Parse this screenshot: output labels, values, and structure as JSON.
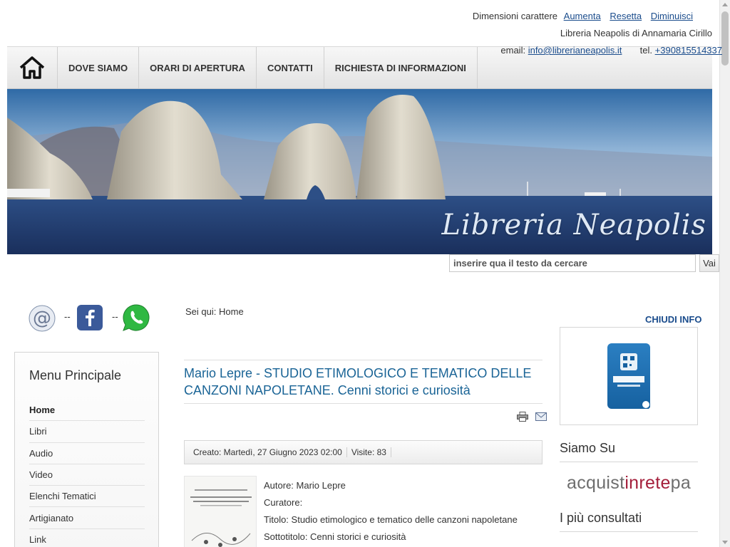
{
  "topbar": {
    "font_size_label": "Dimensioni carattere",
    "increase": "Aumenta",
    "reset": "Resetta",
    "decrease": "Diminuisci",
    "owner": "Libreria Neapolis di Annamaria Cirillo",
    "email_label": "email:",
    "email": "info@librerianeapolis.it",
    "phone_label": "tel.",
    "phone": "+390815514337"
  },
  "nav": {
    "home_icon": "home-icon",
    "items": [
      {
        "label": "DOVE SIAMO"
      },
      {
        "label": "ORARI DI APERTURA"
      },
      {
        "label": "CONTATTI"
      },
      {
        "label": "RICHIESTA DI INFORMAZIONI"
      }
    ]
  },
  "banner": {
    "title": "Libreria Neapolis"
  },
  "search": {
    "value": "inserire qua il testo da cercare",
    "button": "Vai"
  },
  "social": {
    "separator": "--",
    "icons": [
      "email-icon",
      "facebook-icon",
      "whatsapp-icon"
    ]
  },
  "menu": {
    "heading": "Menu Principale",
    "items": [
      {
        "label": "Home",
        "active": true
      },
      {
        "label": "Libri"
      },
      {
        "label": "Audio"
      },
      {
        "label": "Video"
      },
      {
        "label": "Elenchi Tematici"
      },
      {
        "label": "Artigianato"
      },
      {
        "label": "Link"
      }
    ]
  },
  "breadcrumb": {
    "prefix": "Sei qui:",
    "current": "Home"
  },
  "article": {
    "title": "Mario Lepre - STUDIO ETIMOLOGICO E TEMATICO DELLE CANZONI NAPOLETANE. Cenni storici e curiosità",
    "created": "Creato: Martedì, 27 Giugno 2023 02:00",
    "visits": "Visite: 83",
    "fields": [
      "Autore: Mario Lepre",
      "Curatore:",
      "Titolo: Studio etimologico e tematico delle canzoni napoletane",
      "Sottotitolo: Cenni storici e curiosità"
    ],
    "tools": [
      "print-icon",
      "email-icon"
    ]
  },
  "sidebar": {
    "close_info": "CHIUDI INFO",
    "siamo_su": "Siamo Su",
    "acquisti_part1": "acquist",
    "acquisti_part2": "inrete",
    "acquisti_part3": "pa",
    "piu_consultati": "I più consultati"
  },
  "colors": {
    "link": "#1a4c8c",
    "title": "#1a6496",
    "brand_red": "#a41f3b"
  }
}
